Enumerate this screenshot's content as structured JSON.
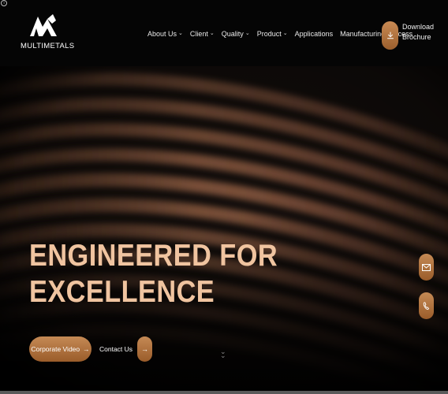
{
  "brand": {
    "name": "MULTIMETALS"
  },
  "nav": {
    "items": [
      {
        "label": "About Us",
        "has_dropdown": true
      },
      {
        "label": "Client",
        "has_dropdown": true
      },
      {
        "label": "Quality",
        "has_dropdown": true
      },
      {
        "label": "Product",
        "has_dropdown": true
      },
      {
        "label": "Applications",
        "has_dropdown": false
      },
      {
        "label": "Manufacturing Process",
        "has_dropdown": false
      }
    ],
    "chevron": "⌄"
  },
  "download": {
    "line1": "Download",
    "line2": "Brochure",
    "icon": "download-icon"
  },
  "hero": {
    "headline_line1": "ENGINEERED FOR",
    "headline_line2": "EXCELLENCE",
    "cta_primary": "Corporate Video",
    "cta_secondary": "Contact Us",
    "arrow": "→"
  },
  "side": {
    "mail_icon": "mail-icon",
    "phone_icon": "phone-icon"
  },
  "colors": {
    "accent": "#b97840",
    "headline": "#f0c4a0",
    "header_bg": "#050505"
  }
}
